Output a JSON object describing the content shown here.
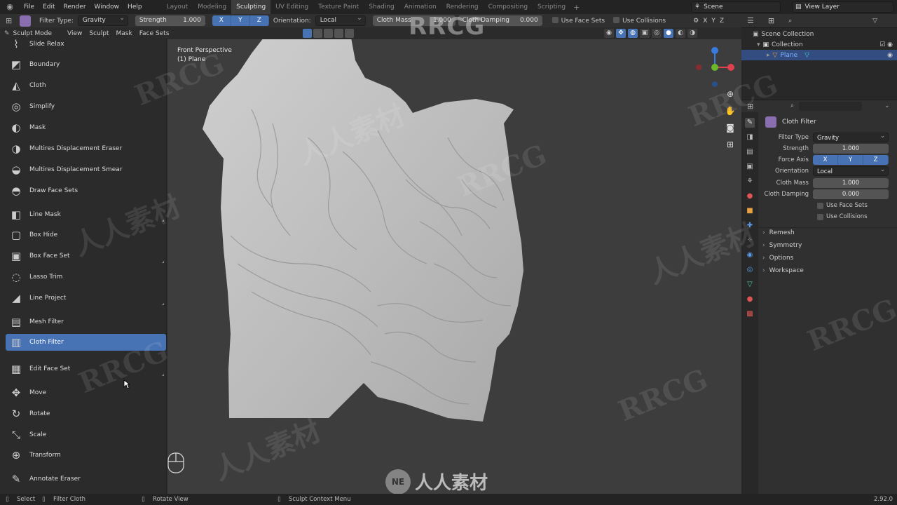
{
  "menubar": {
    "menus": [
      "File",
      "Edit",
      "Render",
      "Window",
      "Help"
    ],
    "workspaces": [
      "Layout",
      "Modeling",
      "Sculpting",
      "UV Editing",
      "Texture Paint",
      "Shading",
      "Animation",
      "Rendering",
      "Compositing",
      "Scripting"
    ],
    "active_workspace": "Sculpting",
    "scene": "Scene",
    "view_layer": "View Layer"
  },
  "tool_header": {
    "filter_type_label": "Filter Type:",
    "filter_type_value": "Gravity",
    "strength_label": "Strength",
    "strength_value": "1.000",
    "axes": [
      "X",
      "Y",
      "Z"
    ],
    "orientation_label": "Orientation:",
    "orientation_value": "Local",
    "cloth_mass_label": "Cloth Mass",
    "cloth_mass_value": "1.000",
    "cloth_damping_label": "Cloth Damping",
    "cloth_damping_value": "0.000",
    "use_face_sets": "Use Face Sets",
    "use_collisions": "Use Collisions"
  },
  "mode_header": {
    "mode": "Sculpt Mode",
    "menus": [
      "View",
      "Sculpt",
      "Mask",
      "Face Sets"
    ]
  },
  "tools": [
    {
      "label": "Slide Relax",
      "icon": "slide-relax-icon",
      "glyph": "⌇"
    },
    {
      "label": "Boundary",
      "icon": "boundary-icon",
      "glyph": "◩"
    },
    {
      "label": "Cloth",
      "icon": "cloth-icon",
      "glyph": "◭"
    },
    {
      "label": "Simplify",
      "icon": "simplify-icon",
      "glyph": "◎"
    },
    {
      "label": "Mask",
      "icon": "mask-icon",
      "glyph": "◐"
    },
    {
      "label": "Multires Displacement Eraser",
      "icon": "multires-eraser-icon",
      "glyph": "◑"
    },
    {
      "label": "Multires Displacement Smear",
      "icon": "multires-smear-icon",
      "glyph": "◒"
    },
    {
      "label": "Draw Face Sets",
      "icon": "draw-face-sets-icon",
      "glyph": "◓"
    },
    {
      "label": "Line Mask",
      "icon": "line-mask-icon",
      "glyph": "◧"
    },
    {
      "label": "Box Hide",
      "icon": "box-hide-icon",
      "glyph": "▢"
    },
    {
      "label": "Box Face Set",
      "icon": "box-face-set-icon",
      "glyph": "▣"
    },
    {
      "label": "Lasso Trim",
      "icon": "lasso-trim-icon",
      "glyph": "◌"
    },
    {
      "label": "Line Project",
      "icon": "line-project-icon",
      "glyph": "◢"
    },
    {
      "label": "Mesh Filter",
      "icon": "mesh-filter-icon",
      "glyph": "▤"
    },
    {
      "label": "Cloth Filter",
      "icon": "cloth-filter-icon",
      "glyph": "▥"
    },
    {
      "label": "Edit Face Set",
      "icon": "edit-face-set-icon",
      "glyph": "▦"
    },
    {
      "label": "Move",
      "icon": "move-icon",
      "glyph": "✥"
    },
    {
      "label": "Rotate",
      "icon": "rotate-icon",
      "glyph": "↻"
    },
    {
      "label": "Scale",
      "icon": "scale-icon",
      "glyph": "⤡"
    },
    {
      "label": "Transform",
      "icon": "transform-icon",
      "glyph": "⊕"
    },
    {
      "label": "Annotate Eraser",
      "icon": "annotate-eraser-icon",
      "glyph": "✎"
    }
  ],
  "active_tool": "Cloth Filter",
  "viewport": {
    "perspective": "Front Perspective",
    "object": "(1) Plane"
  },
  "outliner": {
    "rows": [
      {
        "label": "Scene Collection"
      },
      {
        "label": "Collection"
      },
      {
        "label": "Plane"
      }
    ]
  },
  "properties": {
    "panel_title": "Cloth Filter",
    "filter_type_label": "Filter Type",
    "filter_type_value": "Gravity",
    "strength_label": "Strength",
    "strength_value": "1.000",
    "force_axis_label": "Force Axis",
    "axes": [
      "X",
      "Y",
      "Z"
    ],
    "orientation_label": "Orientation",
    "orientation_value": "Local",
    "cloth_mass_label": "Cloth Mass",
    "cloth_mass_value": "1.000",
    "cloth_damping_label": "Cloth Damping",
    "cloth_damping_value": "0.000",
    "use_face_sets": "Use Face Sets",
    "use_collisions": "Use Collisions",
    "subpanels": [
      "Remesh",
      "Symmetry",
      "Options",
      "Workspace"
    ]
  },
  "statusbar": {
    "select": "Select",
    "filter_cloth": "Filter Cloth",
    "rotate_view": "Rotate View",
    "context_menu": "Sculpt Context Menu",
    "version": "2.92.0"
  },
  "watermark": {
    "top": "RRCG",
    "bottom": "人人素材",
    "repeat_latin": "RRCG",
    "repeat_cjk": "人人素材"
  },
  "colors": {
    "accent": "#4772b3",
    "selected_row": "#334d80"
  }
}
